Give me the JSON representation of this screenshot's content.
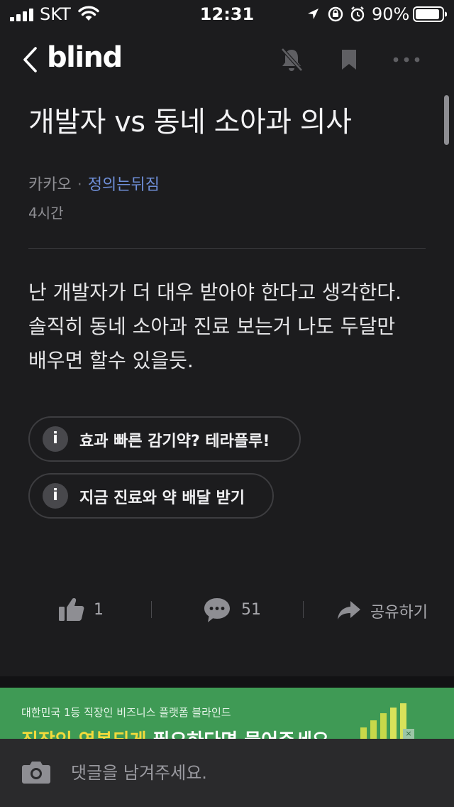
{
  "status_bar": {
    "carrier": "SKT",
    "time": "12:31",
    "battery": "90%",
    "icons": [
      "signal-icon",
      "wifi-icon",
      "location-icon",
      "orientation-lock-icon",
      "alarm-icon",
      "battery-icon"
    ]
  },
  "nav": {
    "logo": "blind",
    "icons": [
      "back-icon",
      "bell-muted-icon",
      "bookmark-icon",
      "more-icon"
    ]
  },
  "post": {
    "title": "개발자 vs 동네 소아과 의사",
    "company": "카카오",
    "separator": "·",
    "nickname": "정의는뒤짐",
    "time": "4시간",
    "body": [
      "난 개발자가 더 대우 받아야 한다고 생각한다.",
      "솔직히 동네 소아과 진료 보는거 나도 두달만",
      "배우면 할수 있을듯."
    ]
  },
  "ads": [
    {
      "icon": "i",
      "label": "효과 빠른 감기약? 테라플루!"
    },
    {
      "icon": "i",
      "label": "지금 진료와 약 배달 받기"
    }
  ],
  "actions": {
    "like_count": "1",
    "comment_count": "51",
    "share_label": "공유하기"
  },
  "banner": {
    "subtitle": "대한민국 1등 직장인 비즈니스 플랫폼 블라인드",
    "headline_highlight": "직장인 연봉되게",
    "headline_rest": " 필요하다면 물어주세요",
    "close": "×",
    "color": "#3f9a55"
  },
  "comment_bar": {
    "placeholder": "댓글을 남겨주세요."
  },
  "colors": {
    "background": "#1c1c1e",
    "nickname": "#6f8fd8",
    "muted": "#8e8e93"
  }
}
